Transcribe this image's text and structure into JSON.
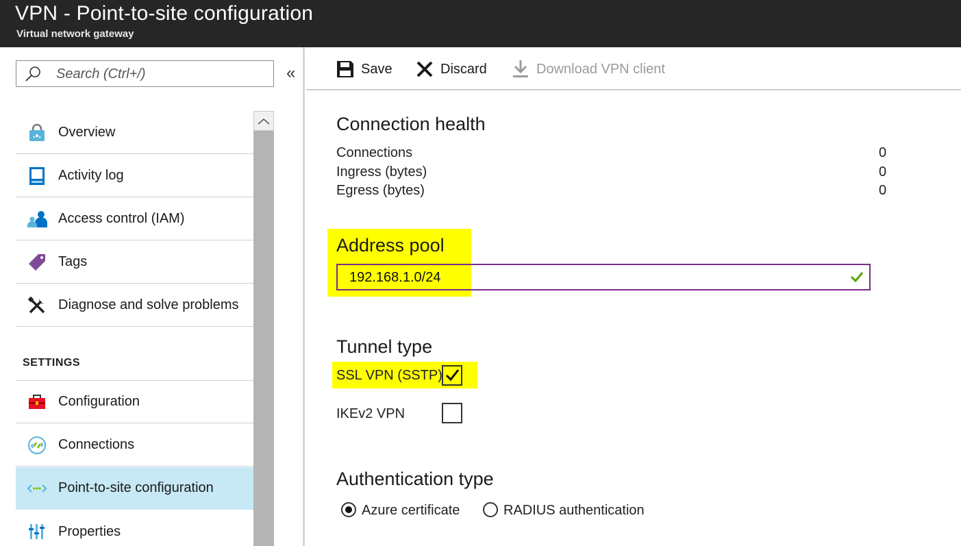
{
  "header": {
    "title": "VPN - Point-to-site configuration",
    "subtitle": "Virtual network gateway"
  },
  "sidebar": {
    "search_placeholder": "Search (Ctrl+/)",
    "collapse_glyph": "«",
    "items": [
      {
        "label": "Overview",
        "icon": "overview-icon"
      },
      {
        "label": "Activity log",
        "icon": "activity-log-icon"
      },
      {
        "label": "Access control (IAM)",
        "icon": "iam-icon"
      },
      {
        "label": "Tags",
        "icon": "tag-icon"
      },
      {
        "label": "Diagnose and solve problems",
        "icon": "wrench-icon"
      }
    ],
    "section_label": "SETTINGS",
    "settings_items": [
      {
        "label": "Configuration",
        "icon": "toolbox-icon"
      },
      {
        "label": "Connections",
        "icon": "connections-icon"
      },
      {
        "label": "Point-to-site configuration",
        "icon": "point-to-site-icon",
        "active": true
      },
      {
        "label": "Properties",
        "icon": "properties-icon"
      }
    ]
  },
  "toolbar": {
    "save_label": "Save",
    "discard_label": "Discard",
    "download_label": "Download VPN client"
  },
  "connection_health": {
    "title": "Connection health",
    "rows": [
      {
        "label": "Connections",
        "value": "0"
      },
      {
        "label": "Ingress (bytes)",
        "value": "0"
      },
      {
        "label": "Egress (bytes)",
        "value": "0"
      }
    ]
  },
  "address_pool": {
    "title": "Address pool",
    "value": "192.168.1.0/24"
  },
  "tunnel_type": {
    "title": "Tunnel type",
    "options": [
      {
        "label": "SSL VPN (SSTP)",
        "checked": true
      },
      {
        "label": "IKEv2 VPN",
        "checked": false
      }
    ]
  },
  "authentication_type": {
    "title": "Authentication type",
    "options": [
      {
        "label": "Azure certificate",
        "selected": true
      },
      {
        "label": "RADIUS authentication",
        "selected": false
      }
    ]
  },
  "colors": {
    "header_bg": "#262626",
    "active_nav": "#c7e8f5",
    "highlight": "#ffff00",
    "input_border": "#7b2a8c",
    "valid_check": "#57a300"
  }
}
